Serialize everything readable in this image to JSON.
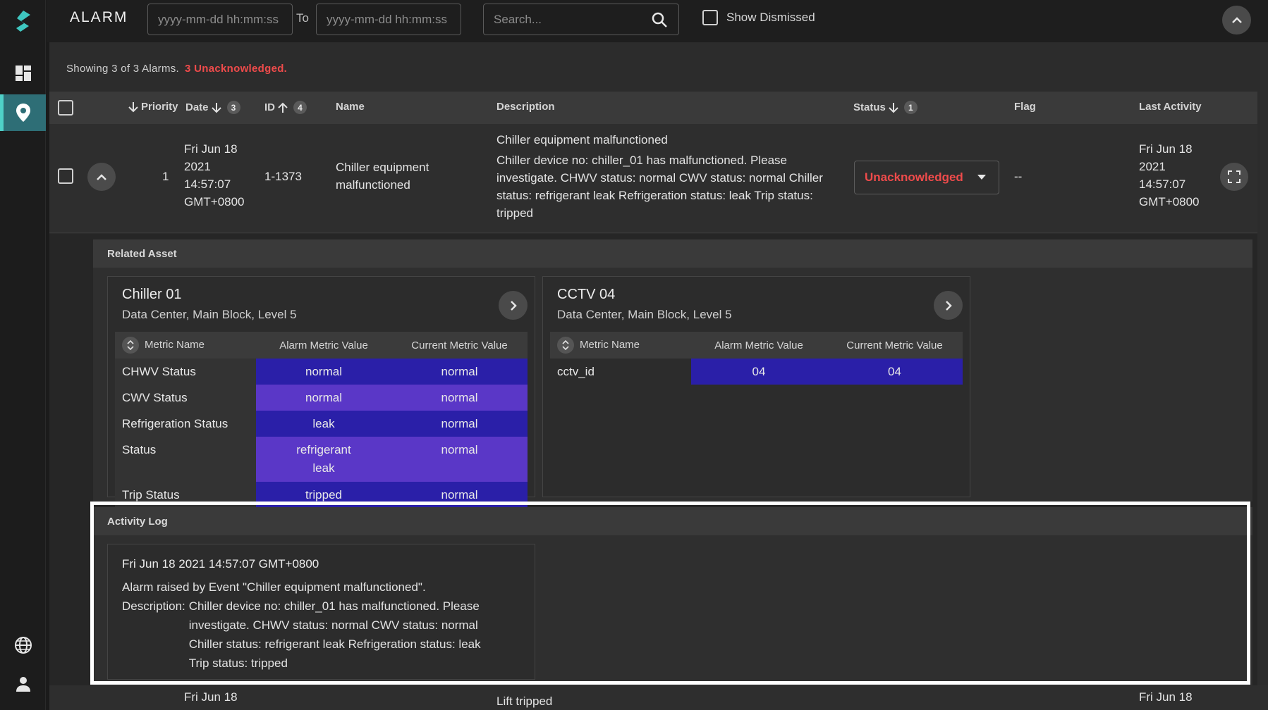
{
  "app": {
    "title": "ALARM"
  },
  "filters": {
    "from_placeholder": "yyyy-mm-dd hh:mm:ss",
    "to_label": "To",
    "to_placeholder": "yyyy-mm-dd hh:mm:ss",
    "search_placeholder": "Search...",
    "show_dismissed_label": "Show Dismissed",
    "show_dismissed_checked": false
  },
  "summary": {
    "showing": "Showing 3 of 3 Alarms.",
    "unacknowledged": "3 Unacknowledged."
  },
  "columns": [
    {
      "key": "priority",
      "label": "Priority",
      "sort": "desc"
    },
    {
      "key": "date",
      "label": "Date",
      "sort": "desc",
      "order": "3"
    },
    {
      "key": "id",
      "label": "ID",
      "sort": "asc",
      "order": "4"
    },
    {
      "key": "name",
      "label": "Name"
    },
    {
      "key": "description",
      "label": "Description"
    },
    {
      "key": "status",
      "label": "Status",
      "sort": "desc",
      "order": "1"
    },
    {
      "key": "flag",
      "label": "Flag"
    },
    {
      "key": "last_activity",
      "label": "Last Activity"
    }
  ],
  "alarm": {
    "priority": "1",
    "date_lines": [
      "Fri Jun 18",
      "2021",
      "14:57:07",
      "GMT+0800"
    ],
    "id": "1-1373",
    "name_lines": [
      "Chiller equipment",
      "malfunctioned"
    ],
    "desc_title": "Chiller equipment malfunctioned",
    "desc_lines": [
      "Chiller device no: chiller_01 has malfunctioned. Please",
      "investigate. CHWV status: normal CWV status: normal Chiller",
      "status: refrigerant leak Refrigeration status: leak Trip status:",
      "tripped"
    ],
    "status": "Unacknowledged",
    "flag": "--",
    "last_activity_lines": [
      "Fri Jun 18",
      "2021",
      "14:57:07",
      "GMT+0800"
    ]
  },
  "related_asset": {
    "heading": "Related Asset",
    "table_headers": {
      "metric": "Metric Name",
      "alarm": "Alarm Metric Value",
      "current": "Current Metric Value"
    },
    "assets": [
      {
        "name": "Chiller 01",
        "location": "Data Center, Main Block, Level 5",
        "metrics": [
          {
            "name": "CHWV Status",
            "alarm": "normal",
            "current": "normal"
          },
          {
            "name": "CWV Status",
            "alarm": "normal",
            "current": "normal"
          },
          {
            "name": "Refrigeration Status",
            "alarm": "leak",
            "current": "normal"
          },
          {
            "name": "Status",
            "alarm": "refrigerant leak",
            "current": "normal"
          },
          {
            "name": "Trip Status",
            "alarm": "tripped",
            "current": "normal"
          }
        ]
      },
      {
        "name": "CCTV 04",
        "location": "Data Center, Main Block, Level 5",
        "metrics": [
          {
            "name": "cctv_id",
            "alarm": "04",
            "current": "04"
          }
        ]
      }
    ]
  },
  "activity_log": {
    "heading": "Activity Log",
    "entries": [
      {
        "timestamp": "Fri Jun 18 2021 14:57:07 GMT+0800",
        "message": "Alarm raised by Event \"Chiller equipment malfunctioned\".",
        "description_label": "Description:",
        "description_lines": [
          "Chiller device no: chiller_01 has malfunctioned. Please",
          "investigate. CHWV status: normal CWV status: normal",
          "Chiller status: refrigerant leak Refrigeration status: leak",
          "Trip status: tripped"
        ]
      }
    ]
  },
  "next_row": {
    "date": "Fri Jun 18",
    "description": "Lift tripped",
    "last_activity": "Fri Jun 18"
  },
  "colors": {
    "accent": "#4fd0c8",
    "unacknowledged": "#ef4b4b",
    "metric_dark": "#2a1fa8",
    "metric_light": "#5a37c7"
  }
}
